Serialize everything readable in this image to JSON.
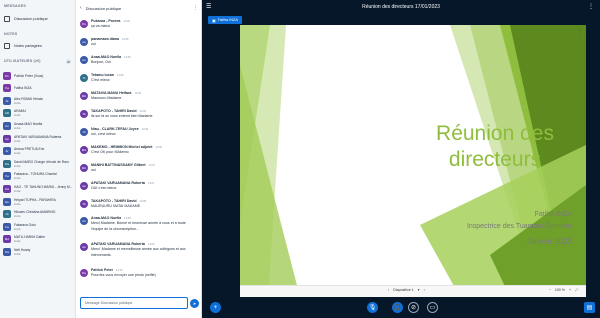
{
  "sidebar": {
    "messages_title": "MESSAGES",
    "public_chat_label": "Discussion publique",
    "notes_title": "NOTES",
    "shared_notes_label": "Notes partagées",
    "users_title": "UTILISATEURS (20)",
    "users": [
      {
        "initials": "Pe",
        "name": "Patrick Peter (Vous)",
        "role": "",
        "color": "#7c3aa8"
      },
      {
        "initials": "Fa",
        "name": "Fatiha INZA",
        "role": "",
        "color": "#7c3aa8"
      },
      {
        "initials": "Al",
        "name": "Alex ROMAI Hiriata",
        "role": "invité",
        "color": "#3a59a8"
      },
      {
        "initials": "AR",
        "name": "ARAMU",
        "role": "invité",
        "color": "#2f6f8a"
      },
      {
        "initials": "An",
        "name": "Anasa-MAO Noella",
        "role": "invité",
        "color": "#3a59a8"
      },
      {
        "initials": "Ap",
        "name": "APATAKI VARUAMANA Roberta",
        "role": "invité",
        "color": "#6b3aa8"
      },
      {
        "initials": "Ar",
        "name": "Arutua FRETUA Eric",
        "role": "invité",
        "color": "#3a59a8"
      },
      {
        "initials": "Da",
        "name": "David MARO Chargé d'école de Raro",
        "role": "invité",
        "color": "#2f6f8a"
      },
      {
        "initials": "Fa",
        "name": "Fakarava - TOHURA Chantal",
        "role": "invité",
        "color": "#3a59a8"
      },
      {
        "initials": "HA",
        "name": "HAO - TE TAHUNO MARIU - Jenny M...",
        "role": "invité",
        "color": "#6b3aa8"
      },
      {
        "initials": "He",
        "name": "Heipari TUPHA - PARAHIRA",
        "role": "invité",
        "color": "#3a59a8"
      },
      {
        "initials": "Hi",
        "name": "Hikueru Christina AMARING",
        "role": "invité",
        "color": "#2f6f8a"
      },
      {
        "initials": "Fa",
        "name": "Fakarava Gotu",
        "role": "invité",
        "color": "#3a59a8"
      },
      {
        "initials": "MA",
        "name": "MATU-HARIM Câline",
        "role": "invité",
        "color": "#6b3aa8"
      },
      {
        "initials": "Na",
        "name": "Nefi Huany",
        "role": "invité",
        "color": "#3a59a8"
      }
    ],
    "count_badge": "20"
  },
  "chat": {
    "title": "Discussion publique",
    "messages": [
      {
        "initials": "Pu",
        "name": "Pukarua - Poerea",
        "time": "13:04",
        "text": "ça va mieux",
        "color": "#7c3aa8"
      },
      {
        "initials": "pa",
        "name": "panamaea diana",
        "time": "13:06",
        "text": "oui",
        "color": "#3a59a8"
      },
      {
        "initials": "An",
        "name": "Anaa-MAO Noella",
        "time": "13:06",
        "text": "Bonjour, Oui",
        "color": "#3a59a8"
      },
      {
        "initials": "Ts",
        "name": "Tetamu lucan",
        "time": "13:06",
        "text": "C'est mieux",
        "color": "#2f6f8a"
      },
      {
        "initials": "MA",
        "name": "MATAIVA MANU Heifara",
        "time": "13:06",
        "text": "Mauruuru Madame",
        "color": "#6b3aa8"
      },
      {
        "initials": "TA",
        "name": "TAKAPOTO - TAHIRI David",
        "time": "13:06",
        "text": "ils sur là on vous entend bien Madame",
        "color": "#6b3aa8"
      },
      {
        "initials": "Ni",
        "name": "Niau - CLARK-TEFAU Joyce",
        "time": "13:06",
        "text": "oui, c'est mieux",
        "color": "#3a59a8"
      },
      {
        "initials": "MA",
        "name": "MAKEMO - HEIMBON Michel adjoint",
        "time": "13:06",
        "text": "C'est OK pour MAkemo",
        "color": "#6b3aa8"
      },
      {
        "initials": "MA",
        "name": "MANIHI BATTINASSAMY Gilbert",
        "time": "13:07",
        "text": "oui",
        "color": "#6b3aa8"
      },
      {
        "initials": "Ap",
        "name": "APATAKI VARUAMANA Roberta",
        "time": "13:07",
        "text": "OUI c'est mieux",
        "color": "#6b3aa8"
      },
      {
        "initials": "TA",
        "name": "TAKAPOTO - TAHIRI David",
        "time": "13:08",
        "text": "MAURUURU MATAI MADAME",
        "color": "#6b3aa8"
      },
      {
        "initials": "An",
        "name": "Anaa-MAO Noella",
        "time": "13:09",
        "text": "Merci Madame, Bonne et heureuse année à vous et à toute l'équipe de la circonscription...",
        "color": "#3a59a8"
      },
      {
        "initials": "Ap",
        "name": "APATAKI VARUAMANA Roberta",
        "time": "13:09",
        "text": "Merci ,Madame et merveilleuse année aux collègues et aux intervenants.",
        "color": "#6b3aa8"
      },
      {
        "initials": "Pa",
        "name": "Patrick Peter",
        "time": "13:10",
        "text": "Pourriez-vous envoyer une photo (selfie)",
        "color": "#7c3aa8"
      }
    ],
    "input_placeholder": "Message Discussion publique"
  },
  "main": {
    "meeting_title": "Réunion des directeurs 17/01/2023",
    "presenter_name": "Fatiha INZA"
  },
  "slide": {
    "title_line1": "Réunion des",
    "title_line2": "directeurs",
    "presenter": "Fatiha INZA",
    "role": "Inspectrice des Tuamotu Gambier",
    "date": "Janvier 2023",
    "page_label": "Diapositive 1",
    "zoom_label": "100 %",
    "colors": {
      "accent_green": "#8fbd3d",
      "dark_green": "#5d8a1f"
    }
  },
  "toolbar": {
    "accent": "#0f70d7"
  }
}
